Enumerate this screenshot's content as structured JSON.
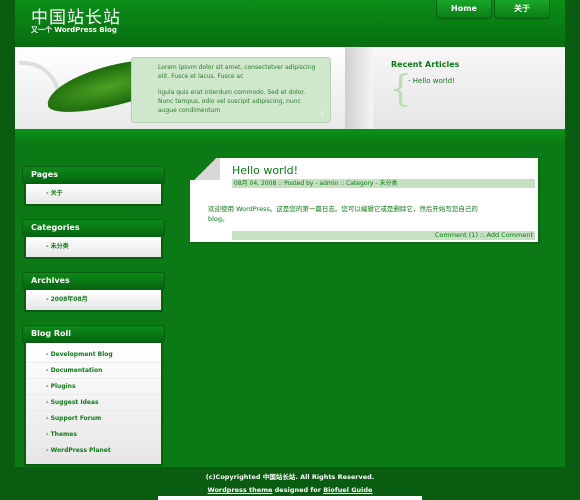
{
  "site": {
    "title": "中国站长站",
    "tagline": "又一个 WordPress Blog"
  },
  "nav": {
    "home": "Home",
    "about": "关于"
  },
  "banner": {
    "lorem_para1": "Lorem ipsvm dolor sit amet, consectetver adipiscing elit. Fusce et lacus. Fusce ac",
    "lorem_para2": "ligula quis erat interdum commodo. Sed et dolor. Nunc tempus, odio vel suscipit adipiscing, nunc augue condimentum",
    "lorem_arrow": "⇩",
    "recent_title": "Recent Articles",
    "recent_brace": "{",
    "recent_items": [
      "Hello world!"
    ]
  },
  "sidebar": {
    "widgets": [
      {
        "title": "Pages",
        "items": [
          "关于"
        ]
      },
      {
        "title": "Categories",
        "items": [
          "未分类"
        ]
      },
      {
        "title": "Archives",
        "items": [
          "2008年08月"
        ]
      },
      {
        "title": "Blog Roll",
        "items": [
          "Development Blog",
          "Documentation",
          "Plugins",
          "Suggest Ideas",
          "Support Forum",
          "Themes",
          "WordPress Planet"
        ]
      }
    ]
  },
  "post": {
    "title": "Hello world!",
    "meta": "08月 04, 2008 :: Posted by - admin :: Category - 未分类",
    "body": "欢迎使用 WordPress。这是您的第一篇日志。您可以编辑它或是删除它，然后开始写您自己的 blog。",
    "footer": "Comment (1) :: Add Comment"
  },
  "footer": {
    "copyright": "(c)Copyrighted 中国站长站. All Rights Reserved.",
    "theme_link": "Wordpress theme",
    "designed_for": "designed for",
    "guide_link": "Biofuel Guide"
  },
  "colors": {
    "page_green": "#0b7a14",
    "dark_green": "#0a5c10",
    "light_green_box": "#cfe7cc"
  }
}
